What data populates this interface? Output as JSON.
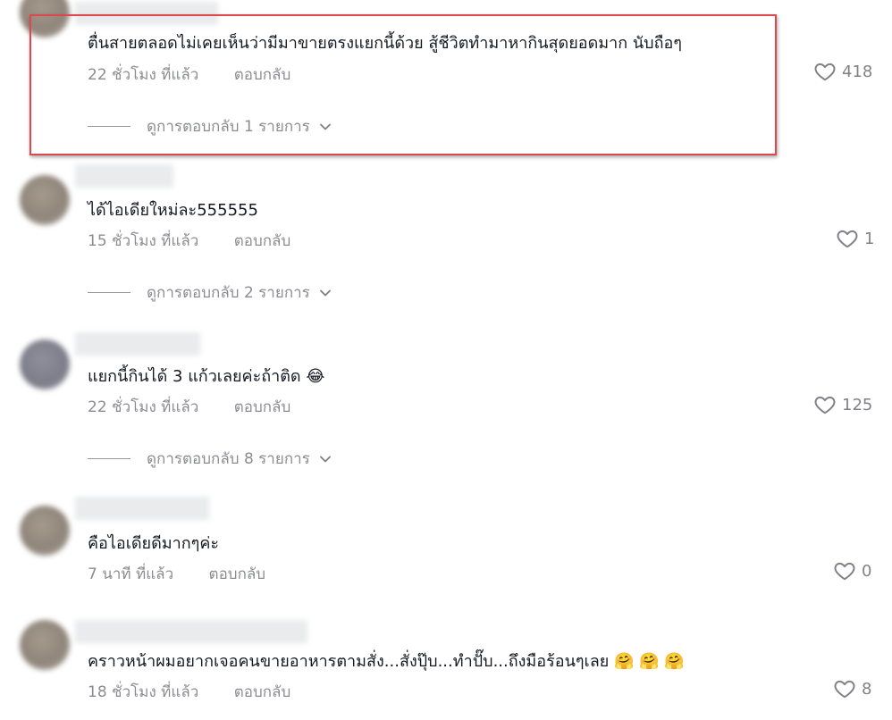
{
  "accent_color": "#e0474c",
  "comments": [
    {
      "text": "ตื่นสายตลอดไม่เคยเห็นว่ามีมาขายตรงแยกนี้ด้วย สู้ชีวิตทำมาหากินสุดยอดมาก นับถือๆ",
      "time": "22 ชั่วโมง ที่แล้ว",
      "reply_label": "ตอบกลับ",
      "likes": "418",
      "view_replies": "ดูการตอบกลับ 1 รายการ"
    },
    {
      "text": "ได้ไอเดียใหม่ละ555555",
      "time": "15 ชั่วโมง ที่แล้ว",
      "reply_label": "ตอบกลับ",
      "likes": "1",
      "view_replies": "ดูการตอบกลับ 2 รายการ"
    },
    {
      "text": "แยกนี้กินได้ 3 แก้วเลยค่ะถ้าติด",
      "emoji": "😂",
      "time": "22 ชั่วโมง ที่แล้ว",
      "reply_label": "ตอบกลับ",
      "likes": "125",
      "view_replies": "ดูการตอบกลับ 8 รายการ"
    },
    {
      "text": "คือไอเดียดีมากๆค่ะ",
      "time": "7 นาที ที่แล้ว",
      "reply_label": "ตอบกลับ",
      "likes": "0"
    },
    {
      "text": "คราวหน้าผมอยากเจอคนขายอาหารตามสั่ง...สั่งปุ๊บ...ทำปั๊บ...ถึงมือร้อนๆเลย",
      "emoji": "🤗 🤗 🤗",
      "time": "18 ชั่วโมง ที่แล้ว",
      "reply_label": "ตอบกลับ",
      "likes": "8"
    }
  ]
}
